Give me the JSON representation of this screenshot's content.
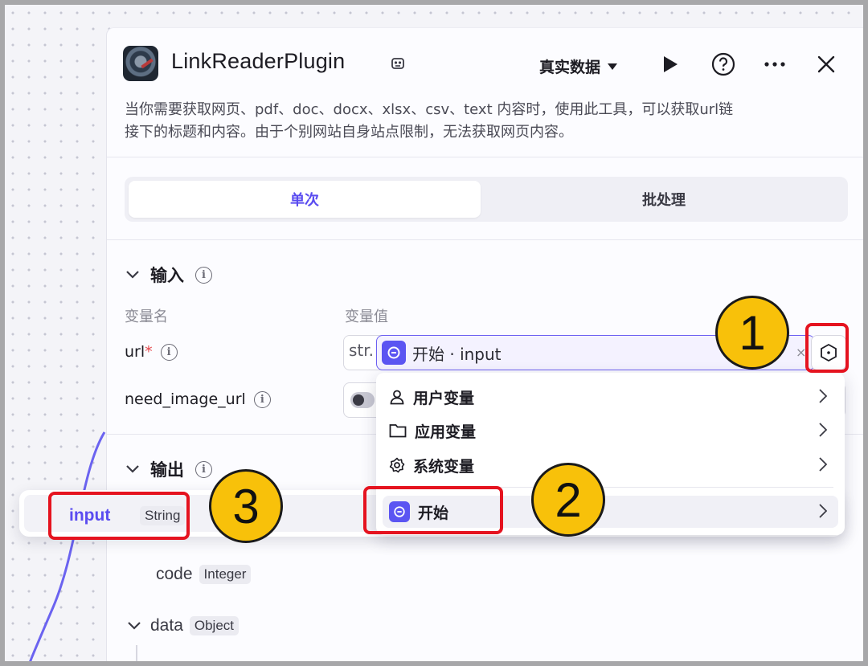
{
  "plugin": {
    "title": "LinkReaderPlugin",
    "data_mode": "真实数据",
    "description_line1": "当你需要获取网页、pdf、doc、docx、xlsx、csv、text 内容时，使用此工具，可以获取url链",
    "description_line2": "接下的标题和内容。由于个别网站自身站点限制，无法获取网页内容。"
  },
  "tabs": {
    "single": "单次",
    "batch": "批处理"
  },
  "input_section": {
    "title": "输入",
    "col_name": "变量名",
    "col_value": "变量值",
    "url_label": "url",
    "url_required": "*",
    "url_type": "str.",
    "url_ref": "开始 · input",
    "clear": "×",
    "need_image_label": "need_image_url"
  },
  "output_section": {
    "title": "输出",
    "rows": [
      {
        "name": "code",
        "type": "Integer"
      },
      {
        "name": "data",
        "type": "Object"
      }
    ]
  },
  "floating_row": {
    "name": "input",
    "type": "String"
  },
  "variable_menu": {
    "items": [
      "用户变量",
      "应用变量",
      "系统变量"
    ],
    "start": "开始"
  },
  "annotations": {
    "badge1": "1",
    "badge2": "2",
    "badge3": "3"
  },
  "colors": {
    "accent": "#5a4cf0",
    "highlight": "#e5131f",
    "badge": "#f8c10a"
  }
}
